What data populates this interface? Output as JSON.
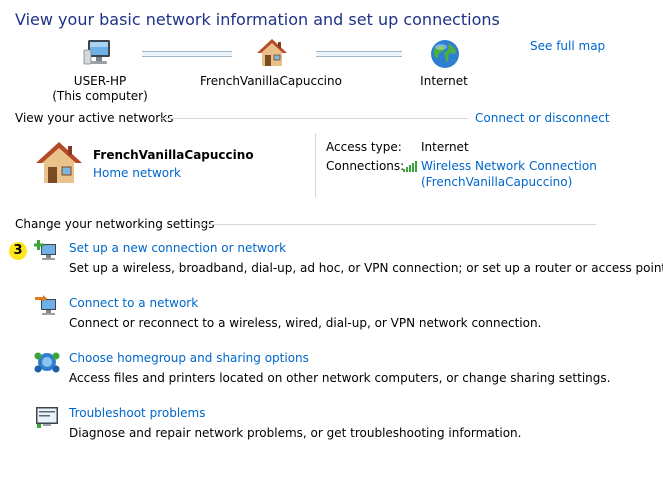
{
  "header": {
    "title": "View your basic network information and set up connections",
    "see_full_map": "See full map"
  },
  "map": {
    "computer": {
      "name": "USER-HP",
      "sub": "(This computer)",
      "icon": "computer-icon"
    },
    "network": {
      "name": "FrenchVanillaCapuccino",
      "icon": "house-icon"
    },
    "internet": {
      "name": "Internet",
      "icon": "globe-icon"
    }
  },
  "active": {
    "heading": "View your active networks",
    "connect_link": "Connect or disconnect",
    "network_name": "FrenchVanillaCapuccino",
    "network_type": "Home network",
    "access_label": "Access type:",
    "access_value": "Internet",
    "connections_label": "Connections:",
    "connection_line1": "Wireless Network Connection",
    "connection_line2": "(FrenchVanillaCapuccino)"
  },
  "settings": {
    "heading": "Change your networking settings",
    "badge": "3",
    "tasks": [
      {
        "title": "Set up a new connection or network",
        "desc": "Set up a wireless, broadband, dial-up, ad hoc, or VPN connection; or set up a router or access point.",
        "icon": "new-connection-icon"
      },
      {
        "title": "Connect to a network",
        "desc": "Connect or reconnect to a wireless, wired, dial-up, or VPN network connection.",
        "icon": "connect-network-icon"
      },
      {
        "title": "Choose homegroup and sharing options",
        "desc": "Access files and printers located on other network computers, or change sharing settings.",
        "icon": "homegroup-icon"
      },
      {
        "title": "Troubleshoot problems",
        "desc": "Diagnose and repair network problems, or get troubleshooting information.",
        "icon": "troubleshoot-icon"
      }
    ]
  }
}
